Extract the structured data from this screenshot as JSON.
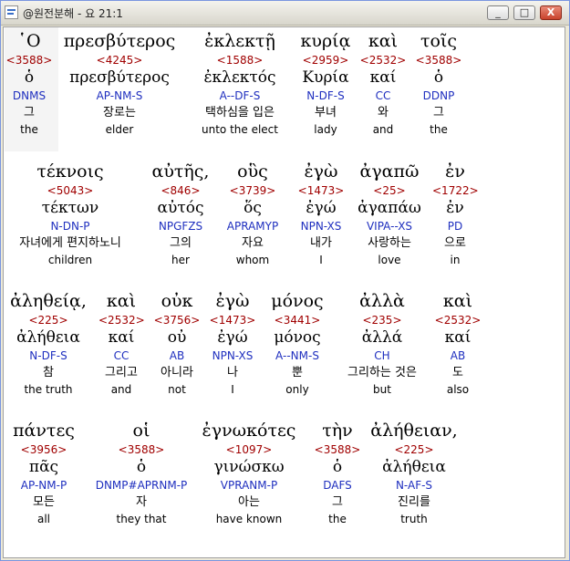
{
  "window": {
    "title": "@원전분해 - 요 21:1",
    "controls": [
      "_",
      "□",
      "X"
    ]
  },
  "blocks": [
    {
      "words": [
        {
          "greek": "῾Ο",
          "strongs": "<3588>",
          "lemma": "ὁ",
          "parse": "DNMS",
          "korean": "그",
          "english": "the"
        },
        {
          "greek": "πρεσβύτερος",
          "strongs": "<4245>",
          "lemma": "πρεσβύτερος",
          "parse": "AP-NM-S",
          "korean": "장로는",
          "english": "elder"
        },
        {
          "greek": "ἐκλεκτῇ",
          "strongs": "<1588>",
          "lemma": "ἐκλεκτός",
          "parse": "A--DF-S",
          "korean": "택하심을 입은",
          "english": "unto the elect"
        },
        {
          "greek": "κυρίᾳ",
          "strongs": "<2959>",
          "lemma": "Κυρία",
          "parse": "N-DF-S",
          "korean": "부녀",
          "english": "lady"
        },
        {
          "greek": "καὶ",
          "strongs": "<2532>",
          "lemma": "καί",
          "parse": "CC",
          "korean": "와",
          "english": "and"
        },
        {
          "greek": "τοῖς",
          "strongs": "<3588>",
          "lemma": "ὁ",
          "parse": "DDNP",
          "korean": "그",
          "english": "the"
        }
      ]
    },
    {
      "words": [
        {
          "greek": "τέκνοις",
          "strongs": "<5043>",
          "lemma": "τέκτων",
          "parse": "N-DN-P",
          "korean": "자녀에게 편지하노니",
          "english": "children"
        },
        {
          "greek": "αὐτῆς,",
          "strongs": "<846>",
          "lemma": "αὐτός",
          "parse": "NPGFZS",
          "korean": "그의",
          "english": "her"
        },
        {
          "greek": "οὓς",
          "strongs": "<3739>",
          "lemma": "ὅς",
          "parse": "APRAMYP",
          "korean": "자요",
          "english": "whom"
        },
        {
          "greek": "ἐγὼ",
          "strongs": "<1473>",
          "lemma": "ἐγώ",
          "parse": "NPN-XS",
          "korean": "내가",
          "english": "I"
        },
        {
          "greek": "ἀγαπῶ",
          "strongs": "<25>",
          "lemma": "ἀγαπάω",
          "parse": "VIPA--XS",
          "korean": "사랑하는",
          "english": "love"
        },
        {
          "greek": "ἐν",
          "strongs": "<1722>",
          "lemma": "ἐν",
          "parse": "PD",
          "korean": "으로",
          "english": "in"
        }
      ]
    },
    {
      "words": [
        {
          "greek": "ἀληθείᾳ,",
          "strongs": "<225>",
          "lemma": "ἀλήθεια",
          "parse": "N-DF-S",
          "korean": "참",
          "english": "the truth"
        },
        {
          "greek": "καὶ",
          "strongs": "<2532>",
          "lemma": "καί",
          "parse": "CC",
          "korean": "그리고",
          "english": "and"
        },
        {
          "greek": "οὐκ",
          "strongs": "<3756>",
          "lemma": "οὐ",
          "parse": "AB",
          "korean": "아니라",
          "english": "not"
        },
        {
          "greek": "ἐγὼ",
          "strongs": "<1473>",
          "lemma": "ἐγώ",
          "parse": "NPN-XS",
          "korean": "나",
          "english": "I"
        },
        {
          "greek": "μόνος",
          "strongs": "<3441>",
          "lemma": "μόνος",
          "parse": "A--NM-S",
          "korean": "뿐",
          "english": "only"
        },
        {
          "greek": "ἀλλὰ",
          "strongs": "<235>",
          "lemma": "ἀλλά",
          "parse": "CH",
          "korean": "그리하는 것은",
          "english": "but"
        },
        {
          "greek": "καὶ",
          "strongs": "<2532>",
          "lemma": "καί",
          "parse": "AB",
          "korean": "도",
          "english": "also"
        }
      ]
    },
    {
      "words": [
        {
          "greek": "πάντες",
          "strongs": "<3956>",
          "lemma": "πᾶς",
          "parse": "AP-NM-P",
          "korean": "모든",
          "english": "all"
        },
        {
          "greek": "οἱ",
          "strongs": "<3588>",
          "lemma": "ὁ",
          "parse": "DNMP#APRNM-P",
          "korean": "자",
          "english": "they that"
        },
        {
          "greek": "ἐγνωκότες",
          "strongs": "<1097>",
          "lemma": "γινώσκω",
          "parse": "VPRANM-P",
          "korean": "아는",
          "english": "have known"
        },
        {
          "greek": "τὴν",
          "strongs": "<3588>",
          "lemma": "ὁ",
          "parse": "DAFS",
          "korean": "그",
          "english": "the"
        },
        {
          "greek": "ἀλήθειαν,",
          "strongs": "<225>",
          "lemma": "ἀλήθεια",
          "parse": "N-AF-S",
          "korean": "진리를",
          "english": "truth"
        }
      ]
    }
  ]
}
